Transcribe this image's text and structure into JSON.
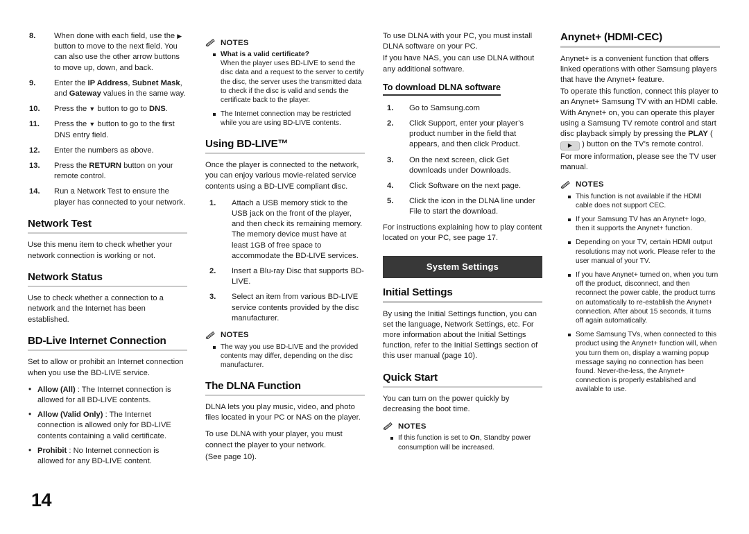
{
  "page": {
    "number": "14"
  },
  "icons": {
    "notes": "pencil-icon",
    "play_key": "play-button-icon"
  },
  "columns": {
    "one": {
      "steps": [
        {
          "num": "8.",
          "text": "When done with each field, use the ▶ button to move to the next field. You can also use the other arrow buttons to move up, down, and back."
        },
        {
          "num": "9.",
          "text": "Enter the IP Address, Subnet Mask, and Gateway values in the same way."
        },
        {
          "num": "10.",
          "text": "Press the ▼ button to go to DNS."
        },
        {
          "num": "11.",
          "text": "Press the ▼ button to go to the first DNS entry field."
        },
        {
          "num": "12.",
          "text": "Enter the numbers as above."
        },
        {
          "num": "13.",
          "text": "Press the RETURN button on your remote control."
        },
        {
          "num": "14.",
          "text": "Run a Network Test to ensure the player has connected to your network."
        }
      ],
      "network_test": {
        "heading": "Network Test",
        "body": "Use this menu item to check whether your network connection is working or not."
      },
      "network_status": {
        "heading": "Network Status",
        "body": "Use to check whether a connection to a network and the Internet has been established."
      },
      "bdlive_internet": {
        "heading": "BD-Live Internet Connection",
        "body": "Set to allow or prohibit an Internet connection when you use the BD-LIVE service.",
        "options": [
          {
            "term": "Allow (All)",
            "desc": " : The Internet connection is allowed for all BD-LIVE contents."
          },
          {
            "term": "Allow (Valid Only)",
            "desc": " : The Internet connection is allowed only for BD-LIVE contents containing a valid certificate."
          },
          {
            "term": "Prohibit",
            "desc": " : No Internet connection is allowed for any BD-LIVE content."
          }
        ]
      }
    },
    "two": {
      "notes_top": {
        "title": "NOTES",
        "items": [
          {
            "question": "What is a valid certificate?",
            "text": "When the player uses BD-LIVE to send the disc data and a request to the server to certify the disc, the server uses the transmitted data to check if the disc is valid and sends the certificate back to the player."
          },
          {
            "question": "",
            "text": "The Internet connection may be restricted while you are using BD-LIVE contents."
          }
        ]
      },
      "using_bdlive": {
        "heading": "Using BD-LIVE™",
        "body": "Once the player is connected to the network, you can enjoy various movie-related service contents using a BD-LIVE compliant disc.",
        "steps": [
          {
            "num": "1.",
            "text": "Attach a USB memory stick to the USB jack on the front of the player, and then check its remaining memory. The memory device must have at least 1GB of free space to accommodate the BD-LIVE services."
          },
          {
            "num": "2.",
            "text": "Insert a Blu-ray Disc that supports BD-LIVE."
          },
          {
            "num": "3.",
            "text": "Select an item from various BD-LIVE service contents provided by the disc manufacturer."
          }
        ]
      },
      "notes_bdlive": {
        "title": "NOTES",
        "items": [
          {
            "question": "",
            "text": "The way you use BD-LIVE and the provided contents may differ, depending on the disc manufacturer."
          }
        ]
      },
      "dlna": {
        "heading": "The DLNA Function",
        "body1": "DLNA lets you play music, video, and photo files located in your PC or NAS on the player.",
        "body2": "To use DLNA with your player, you must connect the player to your network.",
        "body3": "(See page 10)."
      }
    },
    "three": {
      "intro1": "To use DLNA with your PC, you must install DLNA software on your PC.",
      "intro2": "If you have NAS, you can use DLNA without any additional software.",
      "download_heading": "To download DLNA software",
      "download_steps": [
        {
          "num": "1.",
          "text": "Go to Samsung.com"
        },
        {
          "num": "2.",
          "text": "Click Support, enter your player’s product number in the field that appears, and then click Product."
        },
        {
          "num": "3.",
          "text": "On the next screen, click Get downloads under Downloads."
        },
        {
          "num": "4.",
          "text": "Click Software on the next page."
        },
        {
          "num": "5.",
          "text": "Click the icon in the DLNA line under File to start the download."
        }
      ],
      "closing": "For instructions explaining how to play content located on your PC, see page 17.",
      "banner": "System Settings",
      "initial_settings": {
        "heading": "Initial Settings",
        "body": "By using the Initial Settings function, you can set the language, Network Settings, etc. For more information about the Initial Settings function, refer to the Initial Settings section of this user manual (page 10)."
      },
      "quick_start": {
        "heading": "Quick Start",
        "body": "You can turn on the power quickly by decreasing the boot time."
      },
      "notes": {
        "title": "NOTES",
        "items": [
          {
            "question": "",
            "text_before": "If this function is set to ",
            "bold": "On",
            "text_after": ", Standby power consumption will be increased."
          }
        ]
      }
    },
    "four": {
      "anynet": {
        "heading": "Anynet+ (HDMI-CEC)",
        "para1": "Anynet+ is a convenient function that offers linked operations with other Samsung players that have the Anynet+ feature.",
        "para2_a": "To operate this function, connect this player to an Anynet+ Samsung TV with an HDMI cable. With Anynet+ on, you can operate this player using a Samsung TV remote control and start disc playback simply by pressing the ",
        "para2_bold": "PLAY",
        "para2_b": " ( ",
        "para2_c": " ) button on the TV’s remote control.",
        "para3": "For more information, please see the TV user manual."
      },
      "notes": {
        "title": "NOTES",
        "items": [
          {
            "text": "This function is not available if the HDMI cable does not support CEC."
          },
          {
            "text": "If your Samsung TV has an Anynet+ logo, then it supports the Anynet+ function."
          },
          {
            "text": "Depending on your TV, certain HDMI output resolutions may not work. Please refer to the user manual of your TV."
          },
          {
            "text": "If you have Anynet+ turned on, when you turn off the product, disconnect, and then reconnect the power cable, the product turns on automatically to re-establish the Anynet+ connection. After about 15 seconds, it turns off again automatically."
          },
          {
            "text": "Some Samsung TVs, when connected to this product using the Anynet+ function will, when you turn them on, display a warning popup message saying no connection has been found. Never-the-less, the Anynet+ connection is properly established and available to use."
          }
        ]
      }
    }
  }
}
